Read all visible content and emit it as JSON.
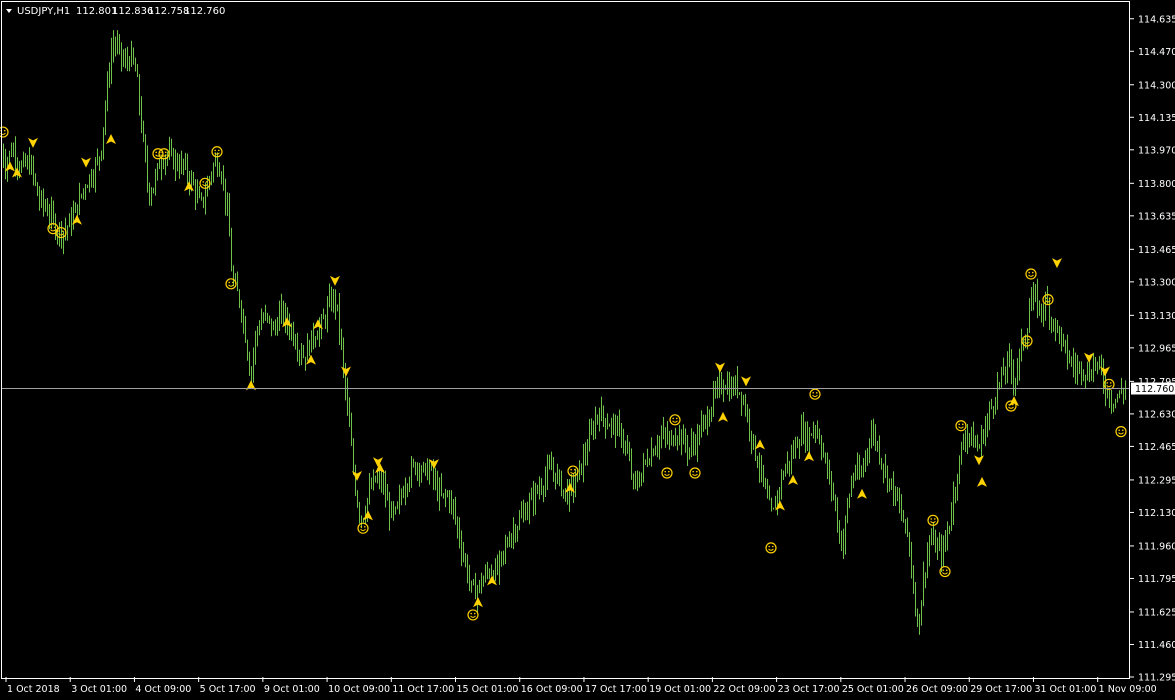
{
  "header": {
    "symbol": "USDJPY,H1",
    "open": "112.801",
    "high": "112.836",
    "low": "112.758",
    "close": "112.760"
  },
  "colors": {
    "background": "#000000",
    "bars": "#6ec24a",
    "frame": "#ffffff",
    "markers": "#ffd200",
    "bid_line": "#a0a0a0"
  },
  "chart_data": {
    "type": "bar",
    "symbol": "USDJPY",
    "timeframe": "H1",
    "ylim": [
      111.295,
      114.72
    ],
    "y_ticks": [
      "114.635",
      "114.470",
      "114.300",
      "114.135",
      "113.970",
      "113.800",
      "113.635",
      "113.465",
      "113.300",
      "113.130",
      "112.965",
      "112.795",
      "112.630",
      "112.465",
      "112.295",
      "112.130",
      "111.960",
      "111.795",
      "111.625",
      "111.460",
      "111.295"
    ],
    "x_ticks": [
      "1 Oct 2018",
      "3 Oct 01:00",
      "4 Oct 09:00",
      "5 Oct 17:00",
      "9 Oct 01:00",
      "10 Oct 09:00",
      "11 Oct 17:00",
      "15 Oct 01:00",
      "16 Oct 09:00",
      "17 Oct 17:00",
      "19 Oct 01:00",
      "22 Oct 09:00",
      "23 Oct 17:00",
      "25 Oct 01:00",
      "26 Oct 09:00",
      "29 Oct 17:00",
      "31 Oct 01:00",
      "1 Nov 09:00"
    ],
    "current_price": "112.760",
    "price_path": [
      [
        0,
        113.99
      ],
      [
        5,
        113.9
      ],
      [
        12,
        113.98
      ],
      [
        20,
        113.88
      ],
      [
        30,
        113.9
      ],
      [
        38,
        113.72
      ],
      [
        48,
        113.66
      ],
      [
        55,
        113.58
      ],
      [
        62,
        113.55
      ],
      [
        70,
        113.6
      ],
      [
        78,
        113.7
      ],
      [
        85,
        113.8
      ],
      [
        92,
        113.85
      ],
      [
        100,
        113.95
      ],
      [
        106,
        114.25
      ],
      [
        112,
        114.52
      ],
      [
        118,
        114.48
      ],
      [
        124,
        114.4
      ],
      [
        130,
        114.45
      ],
      [
        136,
        114.35
      ],
      [
        142,
        114.05
      ],
      [
        148,
        113.75
      ],
      [
        154,
        113.8
      ],
      [
        160,
        113.92
      ],
      [
        166,
        113.95
      ],
      [
        172,
        113.92
      ],
      [
        178,
        113.9
      ],
      [
        184,
        113.88
      ],
      [
        190,
        113.82
      ],
      [
        196,
        113.75
      ],
      [
        200,
        113.68
      ],
      [
        205,
        113.75
      ],
      [
        210,
        113.85
      ],
      [
        216,
        113.92
      ],
      [
        222,
        113.85
      ],
      [
        228,
        113.6
      ],
      [
        232,
        113.3
      ],
      [
        236,
        113.25
      ],
      [
        240,
        113.2
      ],
      [
        246,
        113.0
      ],
      [
        250,
        112.82
      ],
      [
        256,
        113.05
      ],
      [
        262,
        113.12
      ],
      [
        268,
        113.1
      ],
      [
        274,
        113.05
      ],
      [
        280,
        113.15
      ],
      [
        286,
        113.1
      ],
      [
        292,
        113.05
      ],
      [
        298,
        112.97
      ],
      [
        304,
        112.92
      ],
      [
        310,
        113.0
      ],
      [
        316,
        113.05
      ],
      [
        322,
        113.08
      ],
      [
        328,
        113.18
      ],
      [
        334,
        113.22
      ],
      [
        338,
        113.12
      ],
      [
        342,
        112.9
      ],
      [
        346,
        112.7
      ],
      [
        350,
        112.5
      ],
      [
        354,
        112.3
      ],
      [
        358,
        112.15
      ],
      [
        362,
        112.1
      ],
      [
        366,
        112.18
      ],
      [
        370,
        112.25
      ],
      [
        376,
        112.3
      ],
      [
        382,
        112.28
      ],
      [
        388,
        112.15
      ],
      [
        394,
        112.1
      ],
      [
        400,
        112.2
      ],
      [
        406,
        112.3
      ],
      [
        412,
        112.35
      ],
      [
        418,
        112.38
      ],
      [
        424,
        112.33
      ],
      [
        430,
        112.35
      ],
      [
        436,
        112.25
      ],
      [
        442,
        112.2
      ],
      [
        448,
        112.22
      ],
      [
        454,
        112.12
      ],
      [
        460,
        111.98
      ],
      [
        466,
        111.85
      ],
      [
        472,
        111.72
      ],
      [
        478,
        111.75
      ],
      [
        484,
        111.8
      ],
      [
        490,
        111.85
      ],
      [
        496,
        111.82
      ],
      [
        502,
        111.9
      ],
      [
        508,
        112.0
      ],
      [
        514,
        112.05
      ],
      [
        520,
        112.1
      ],
      [
        526,
        112.15
      ],
      [
        532,
        112.2
      ],
      [
        538,
        112.25
      ],
      [
        544,
        112.3
      ],
      [
        550,
        112.35
      ],
      [
        556,
        112.32
      ],
      [
        562,
        112.25
      ],
      [
        568,
        112.22
      ],
      [
        574,
        112.28
      ],
      [
        580,
        112.35
      ],
      [
        586,
        112.45
      ],
      [
        592,
        112.55
      ],
      [
        598,
        112.65
      ],
      [
        604,
        112.6
      ],
      [
        610,
        112.58
      ],
      [
        616,
        112.55
      ],
      [
        622,
        112.52
      ],
      [
        628,
        112.4
      ],
      [
        634,
        112.25
      ],
      [
        640,
        112.32
      ],
      [
        646,
        112.4
      ],
      [
        652,
        112.45
      ],
      [
        658,
        112.5
      ],
      [
        664,
        112.52
      ],
      [
        670,
        112.48
      ],
      [
        676,
        112.55
      ],
      [
        682,
        112.5
      ],
      [
        688,
        112.45
      ],
      [
        694,
        112.48
      ],
      [
        700,
        112.55
      ],
      [
        706,
        112.6
      ],
      [
        712,
        112.7
      ],
      [
        718,
        112.75
      ],
      [
        724,
        112.8
      ],
      [
        730,
        112.75
      ],
      [
        736,
        112.78
      ],
      [
        742,
        112.72
      ],
      [
        748,
        112.6
      ],
      [
        754,
        112.45
      ],
      [
        760,
        112.35
      ],
      [
        766,
        112.2
      ],
      [
        772,
        112.1
      ],
      [
        778,
        112.25
      ],
      [
        784,
        112.35
      ],
      [
        790,
        112.4
      ],
      [
        796,
        112.48
      ],
      [
        802,
        112.55
      ],
      [
        808,
        112.5
      ],
      [
        814,
        112.58
      ],
      [
        820,
        112.5
      ],
      [
        826,
        112.35
      ],
      [
        832,
        112.25
      ],
      [
        838,
        112.05
      ],
      [
        842,
        111.95
      ],
      [
        848,
        112.2
      ],
      [
        854,
        112.35
      ],
      [
        860,
        112.3
      ],
      [
        866,
        112.45
      ],
      [
        872,
        112.55
      ],
      [
        878,
        112.45
      ],
      [
        884,
        112.35
      ],
      [
        890,
        112.28
      ],
      [
        896,
        112.2
      ],
      [
        902,
        112.1
      ],
      [
        908,
        112.0
      ],
      [
        914,
        111.7
      ],
      [
        918,
        111.55
      ],
      [
        922,
        111.75
      ],
      [
        926,
        111.9
      ],
      [
        930,
        112.0
      ],
      [
        936,
        111.95
      ],
      [
        942,
        111.92
      ],
      [
        948,
        112.05
      ],
      [
        954,
        112.25
      ],
      [
        960,
        112.42
      ],
      [
        966,
        112.55
      ],
      [
        972,
        112.5
      ],
      [
        978,
        112.45
      ],
      [
        984,
        112.55
      ],
      [
        990,
        112.65
      ],
      [
        996,
        112.75
      ],
      [
        1002,
        112.82
      ],
      [
        1008,
        112.9
      ],
      [
        1014,
        112.8
      ],
      [
        1020,
        112.95
      ],
      [
        1026,
        113.05
      ],
      [
        1030,
        113.2
      ],
      [
        1034,
        113.22
      ],
      [
        1040,
        113.15
      ],
      [
        1046,
        113.2
      ],
      [
        1052,
        113.1
      ],
      [
        1058,
        113.05
      ],
      [
        1064,
        112.95
      ],
      [
        1070,
        112.9
      ],
      [
        1076,
        112.85
      ],
      [
        1082,
        112.88
      ],
      [
        1088,
        112.82
      ],
      [
        1094,
        112.9
      ],
      [
        1100,
        112.85
      ],
      [
        1106,
        112.75
      ],
      [
        1112,
        112.7
      ],
      [
        1118,
        112.72
      ],
      [
        1124,
        112.76
      ]
    ],
    "markers": [
      {
        "kind": "smiley",
        "x": 3,
        "y": 114.06
      },
      {
        "kind": "up",
        "x": 10,
        "y": 113.88
      },
      {
        "kind": "up",
        "x": 17,
        "y": 113.85
      },
      {
        "kind": "down",
        "x": 33,
        "y": 114.01
      },
      {
        "kind": "smiley",
        "x": 53,
        "y": 113.57
      },
      {
        "kind": "smiley",
        "x": 61,
        "y": 113.55
      },
      {
        "kind": "up",
        "x": 77,
        "y": 113.61
      },
      {
        "kind": "down",
        "x": 86,
        "y": 113.91
      },
      {
        "kind": "up",
        "x": 111,
        "y": 114.02
      },
      {
        "kind": "smiley",
        "x": 158,
        "y": 113.95
      },
      {
        "kind": "smiley",
        "x": 164,
        "y": 113.95
      },
      {
        "kind": "up",
        "x": 189,
        "y": 113.78
      },
      {
        "kind": "smiley",
        "x": 205,
        "y": 113.8
      },
      {
        "kind": "smiley",
        "x": 217,
        "y": 113.96
      },
      {
        "kind": "smiley",
        "x": 231,
        "y": 113.29
      },
      {
        "kind": "up",
        "x": 251,
        "y": 112.77
      },
      {
        "kind": "up",
        "x": 287,
        "y": 113.09
      },
      {
        "kind": "up",
        "x": 311,
        "y": 112.9
      },
      {
        "kind": "up",
        "x": 318,
        "y": 113.08
      },
      {
        "kind": "down",
        "x": 335,
        "y": 113.31
      },
      {
        "kind": "down",
        "x": 346,
        "y": 112.85
      },
      {
        "kind": "down",
        "x": 357,
        "y": 112.32
      },
      {
        "kind": "up",
        "x": 368,
        "y": 112.11
      },
      {
        "kind": "smiley",
        "x": 363,
        "y": 112.05
      },
      {
        "kind": "down",
        "x": 378,
        "y": 112.39
      },
      {
        "kind": "up",
        "x": 380,
        "y": 112.35
      },
      {
        "kind": "down",
        "x": 434,
        "y": 112.38
      },
      {
        "kind": "up",
        "x": 478,
        "y": 111.67
      },
      {
        "kind": "smiley",
        "x": 473,
        "y": 111.61
      },
      {
        "kind": "up",
        "x": 492,
        "y": 111.78
      },
      {
        "kind": "up",
        "x": 570,
        "y": 112.25
      },
      {
        "kind": "smiley",
        "x": 573,
        "y": 112.34
      },
      {
        "kind": "smiley",
        "x": 667,
        "y": 112.33
      },
      {
        "kind": "smiley",
        "x": 675,
        "y": 112.6
      },
      {
        "kind": "smiley",
        "x": 695,
        "y": 112.33
      },
      {
        "kind": "down",
        "x": 720,
        "y": 112.87
      },
      {
        "kind": "up",
        "x": 723,
        "y": 112.61
      },
      {
        "kind": "down",
        "x": 746,
        "y": 112.8
      },
      {
        "kind": "up",
        "x": 760,
        "y": 112.47
      },
      {
        "kind": "smiley",
        "x": 771,
        "y": 111.95
      },
      {
        "kind": "up",
        "x": 780,
        "y": 112.16
      },
      {
        "kind": "up",
        "x": 793,
        "y": 112.29
      },
      {
        "kind": "up",
        "x": 809,
        "y": 112.41
      },
      {
        "kind": "smiley",
        "x": 815,
        "y": 112.73
      },
      {
        "kind": "up",
        "x": 862,
        "y": 112.22
      },
      {
        "kind": "smiley",
        "x": 933,
        "y": 112.09
      },
      {
        "kind": "smiley",
        "x": 945,
        "y": 111.83
      },
      {
        "kind": "smiley",
        "x": 961,
        "y": 112.57
      },
      {
        "kind": "down",
        "x": 979,
        "y": 112.4
      },
      {
        "kind": "up",
        "x": 982,
        "y": 112.28
      },
      {
        "kind": "smiley",
        "x": 1011,
        "y": 112.67
      },
      {
        "kind": "up",
        "x": 1014,
        "y": 112.69
      },
      {
        "kind": "smiley",
        "x": 1027,
        "y": 113.0
      },
      {
        "kind": "smiley",
        "x": 1031,
        "y": 113.34
      },
      {
        "kind": "smiley",
        "x": 1048,
        "y": 113.21
      },
      {
        "kind": "down",
        "x": 1057,
        "y": 113.4
      },
      {
        "kind": "down",
        "x": 1089,
        "y": 112.92
      },
      {
        "kind": "down",
        "x": 1105,
        "y": 112.85
      },
      {
        "kind": "smiley",
        "x": 1109,
        "y": 112.78
      },
      {
        "kind": "smiley",
        "x": 1121,
        "y": 112.54
      }
    ]
  }
}
